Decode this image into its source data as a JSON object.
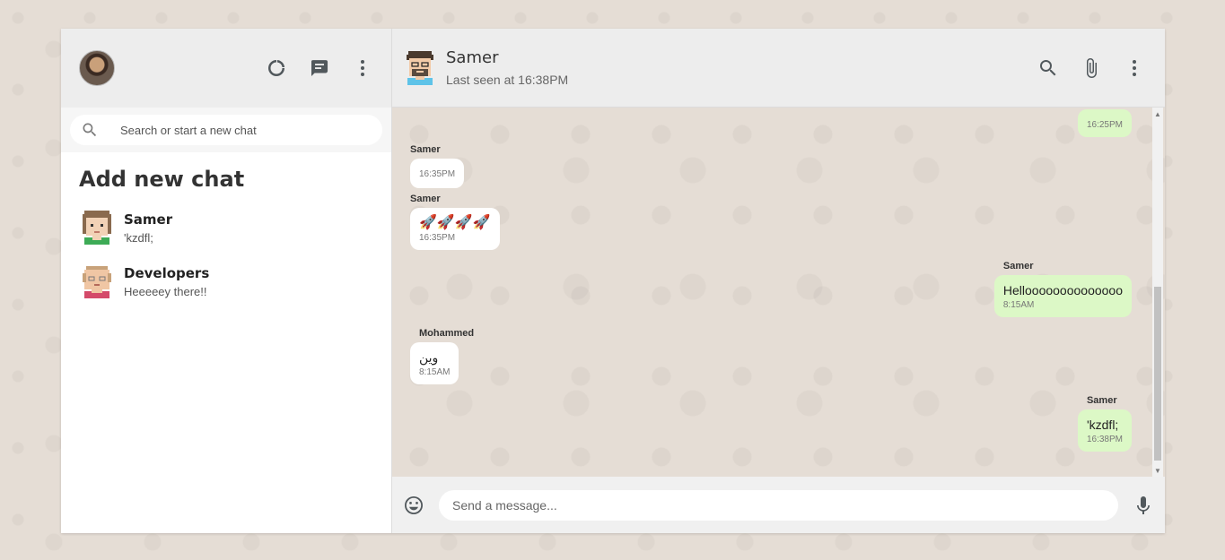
{
  "sidebar": {
    "search_placeholder": "Search or start a new chat",
    "add_chat_title": "Add new chat",
    "chats": [
      {
        "name": "Samer",
        "last": "'kzdfl;"
      },
      {
        "name": "Developers",
        "last": "Heeeeey there!!"
      }
    ],
    "icons": [
      "status-icon",
      "new-chat-icon",
      "menu-icon"
    ]
  },
  "header": {
    "name": "Samer",
    "status": "Last seen at 16:38PM",
    "icons": [
      "search-icon",
      "attach-icon",
      "menu-icon"
    ]
  },
  "messages": [
    {
      "sender": "",
      "text": "",
      "time": "16:25PM",
      "dir": "out"
    },
    {
      "sender": "Samer",
      "text": "",
      "time": "16:35PM",
      "dir": "in"
    },
    {
      "sender": "Samer",
      "text": "🚀🚀🚀🚀",
      "time": "16:35PM",
      "dir": "in"
    },
    {
      "sender": "Samer",
      "text": "Helloooooooooooooo",
      "time": "8:15AM",
      "dir": "out"
    },
    {
      "sender": "Mohammed",
      "text": "وين",
      "time": "8:15AM",
      "dir": "in"
    },
    {
      "sender": "Samer",
      "text": "'kzdfl;",
      "time": "16:38PM",
      "dir": "out"
    }
  ],
  "composer": {
    "placeholder": "Send a message...",
    "icons": [
      "emoji-icon",
      "microphone-icon"
    ]
  },
  "colors": {
    "background": "#e5ddd5",
    "header": "#ededed",
    "bubble_out": "#dcf8c6",
    "bubble_in": "#ffffff"
  }
}
